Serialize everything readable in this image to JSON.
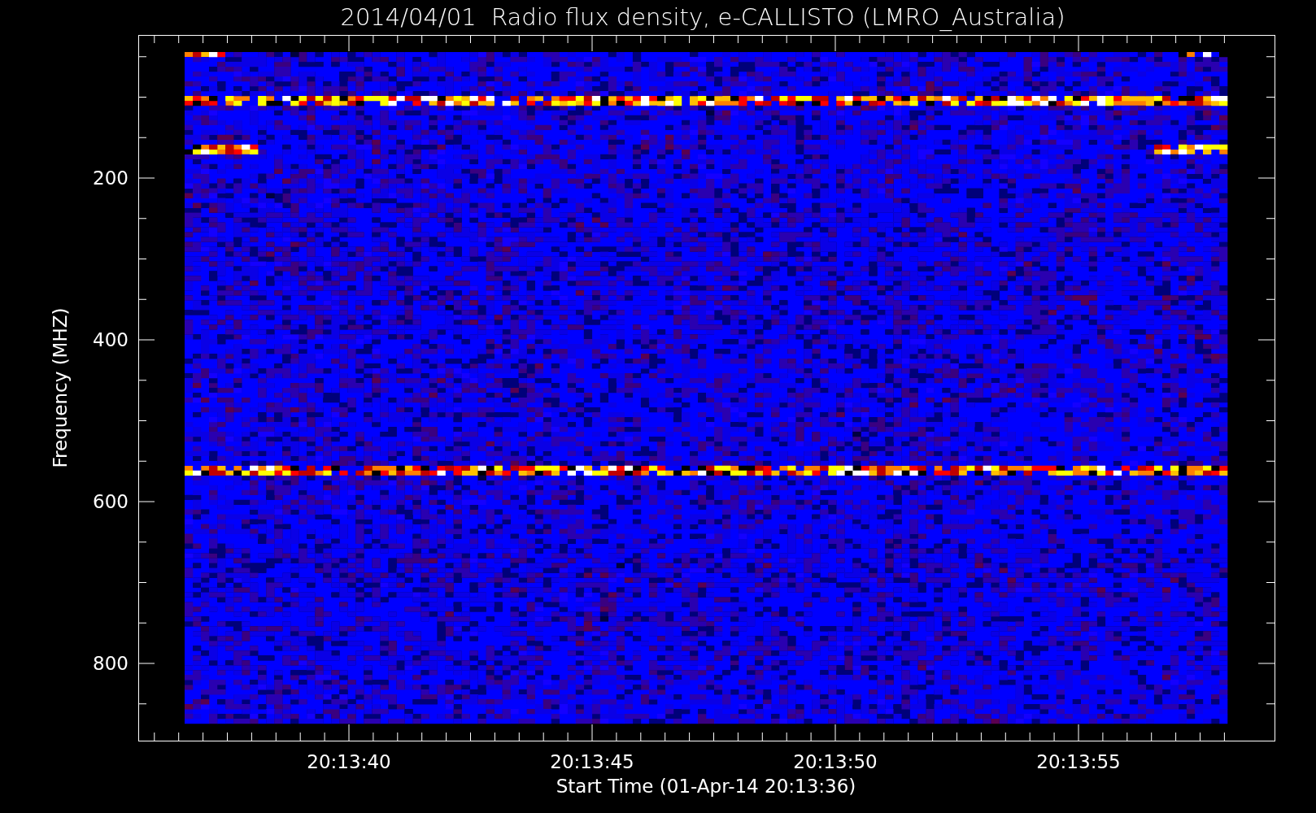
{
  "title": "2014/04/01  Radio flux density, e-CALLISTO (LMRO_Australia)",
  "y_axis": {
    "label": "Frequency (MHZ)",
    "tick_labels": [
      "200",
      "400",
      "600",
      "800"
    ]
  },
  "x_axis": {
    "label": "Start Time (01-Apr-14 20:13:36)",
    "tick_labels": [
      "20:13:40",
      "20:13:45",
      "20:13:50",
      "20:13:55"
    ]
  }
}
